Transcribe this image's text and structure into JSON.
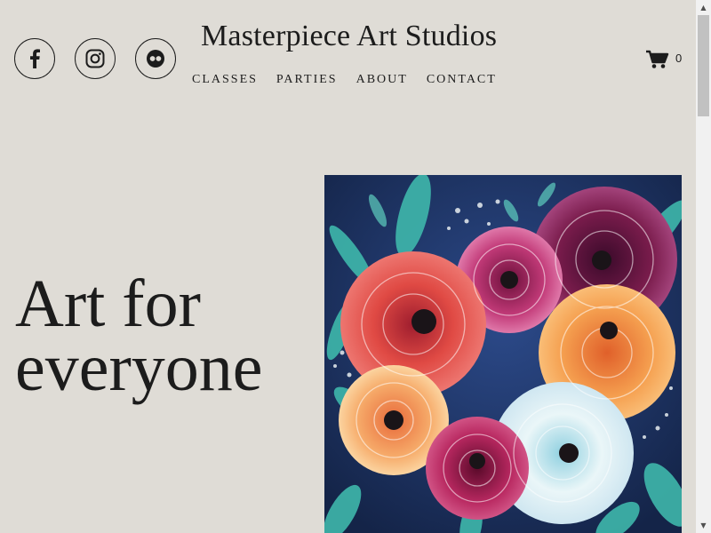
{
  "header": {
    "title": "Masterpiece Art Studios",
    "social": [
      {
        "name": "facebook-icon"
      },
      {
        "name": "instagram-icon"
      },
      {
        "name": "flickr-icon"
      }
    ],
    "nav": [
      "CLASSES",
      "PARTIES",
      "ABOUT",
      "CONTACT"
    ],
    "cart_count": "0"
  },
  "hero": {
    "line1": "Art for",
    "line2": "everyone",
    "image": "flower-painting"
  },
  "colors": {
    "background": "#dfdcd6",
    "text": "#1c1c1c"
  }
}
